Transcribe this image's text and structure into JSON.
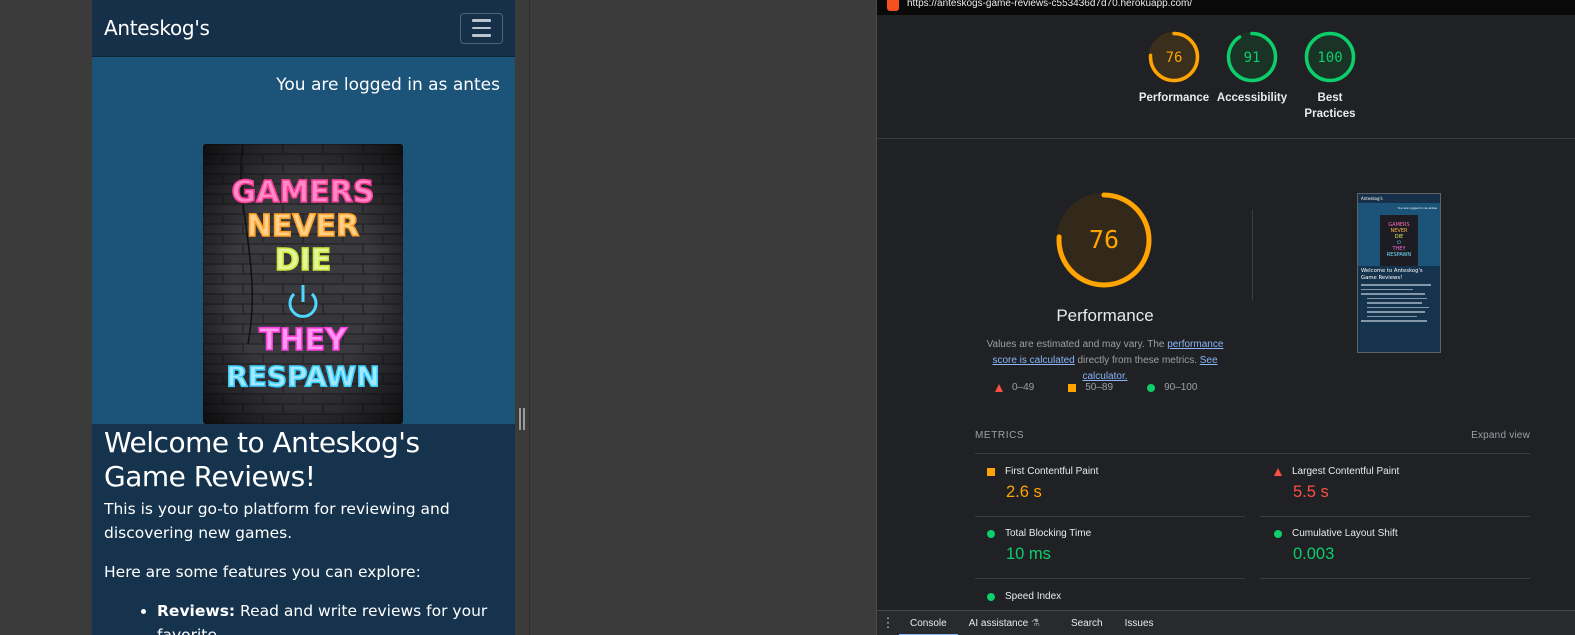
{
  "site": {
    "brand": "Anteskog's",
    "login_status": "You are logged in as antes",
    "poster_lines": [
      "GAMERS",
      "NEVER",
      "DIE",
      "THEY",
      "RESPAWN"
    ],
    "heading": "Welcome to Anteskog's Game Reviews!",
    "intro": "This is your go-to platform for reviewing and discovering new games.",
    "features_intro": "Here are some features you can explore:",
    "features": [
      {
        "title": "Reviews:",
        "text": " Read and write reviews for your favorite"
      }
    ]
  },
  "lighthouse": {
    "url": "https://anteskogs-game-reviews-c553436d7d70.herokuapp.com/",
    "scores": [
      {
        "label": "Performance",
        "value": "76",
        "color": "#ffa400"
      },
      {
        "label": "Accessibility",
        "value": "91",
        "color": "#0cce6b"
      },
      {
        "label": "Best Practices",
        "value": "100",
        "color": "#0cce6b"
      }
    ],
    "performance": {
      "score": "76",
      "title": "Performance",
      "note_prefix": "Values are estimated and may vary. The ",
      "note_link": "performance score is calculated",
      "note_mid": " directly from these metrics. ",
      "note_calc": "See calculator."
    },
    "legend": [
      {
        "range": "0–49",
        "shape": "triangle",
        "color": "#ff4e42"
      },
      {
        "range": "50–89",
        "shape": "square",
        "color": "#ffa400"
      },
      {
        "range": "90–100",
        "shape": "circle",
        "color": "#0cce6b"
      }
    ],
    "metrics_title": "METRICS",
    "expand_view": "Expand view",
    "metrics": [
      {
        "name": "First Contentful Paint",
        "value": "2.6 s",
        "status": "average",
        "color": "#ffa400"
      },
      {
        "name": "Largest Contentful Paint",
        "value": "5.5 s",
        "status": "fail",
        "color": "#ff4e42"
      },
      {
        "name": "Total Blocking Time",
        "value": "10 ms",
        "status": "pass",
        "color": "#0cce6b"
      },
      {
        "name": "Cumulative Layout Shift",
        "value": "0.003",
        "status": "pass",
        "color": "#0cce6b"
      },
      {
        "name": "Speed Index",
        "value": "",
        "status": "pass",
        "color": "#0cce6b"
      }
    ],
    "thumbnail": {
      "brand": "Anteskog's",
      "login": "You are logged in as antes",
      "heading": "Welcome to Anteskog's Game Reviews!"
    }
  },
  "drawer": {
    "tabs": [
      "Console",
      "AI assistance",
      "Search",
      "Issues"
    ],
    "ai_icon": "flask-icon"
  }
}
